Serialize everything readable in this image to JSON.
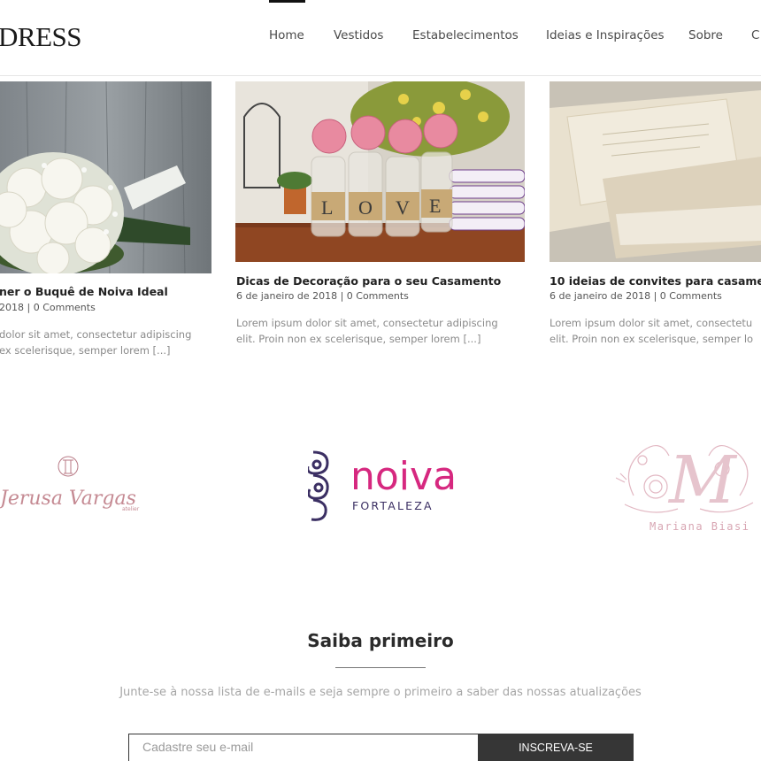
{
  "header": {
    "logo": "DRESS",
    "nav": [
      "Home",
      "Vestidos",
      "Estabelecimentos",
      "Ideias e Inspirações",
      "Sobre",
      "C"
    ]
  },
  "posts": [
    {
      "title": "ner o Buquê de Noiva Ideal",
      "meta": "2018 | 0 Comments",
      "excerpt_line1": "dolor sit amet, consectetur adipiscing",
      "excerpt_line2": "ex scelerisque, semper lorem [...]",
      "image_alt": "bouquet-image"
    },
    {
      "title": "Dicas de Decoração para o seu Casamento",
      "meta": "6 de janeiro de 2018 | 0 Comments",
      "excerpt_line1": "Lorem ipsum dolor sit amet, consectetur adipiscing",
      "excerpt_line2": "elit. Proin non ex scelerisque, semper lorem [...]",
      "image_text": "LOVE"
    },
    {
      "title": "10 ideias de convites para casamer",
      "meta": "6 de janeiro de 2018 | 0 Comments",
      "excerpt_line1": "Lorem ipsum dolor sit amet, consectetu",
      "excerpt_line2": "elit. Proin non ex scelerisque, semper lo",
      "image_alt": "invitations-image"
    }
  ],
  "partners": [
    {
      "name": "Jerusa Vargas",
      "sub": "atelier"
    },
    {
      "name": "noiva",
      "sub": "FORTALEZA"
    },
    {
      "name": "Mariana Biasi",
      "monogram": "M"
    }
  ],
  "newsletter": {
    "title": "Saiba primeiro",
    "subtitle": "Junte-se à nossa lista de e-mails e seja sempre o primeiro a saber das nossas atualizações",
    "placeholder": "Cadastre seu e-mail",
    "button": "INSCREVA-SE"
  },
  "colors": {
    "accent_pink": "#d6287f",
    "noiva_purple": "#3b2f63",
    "button_dark": "#363636"
  }
}
